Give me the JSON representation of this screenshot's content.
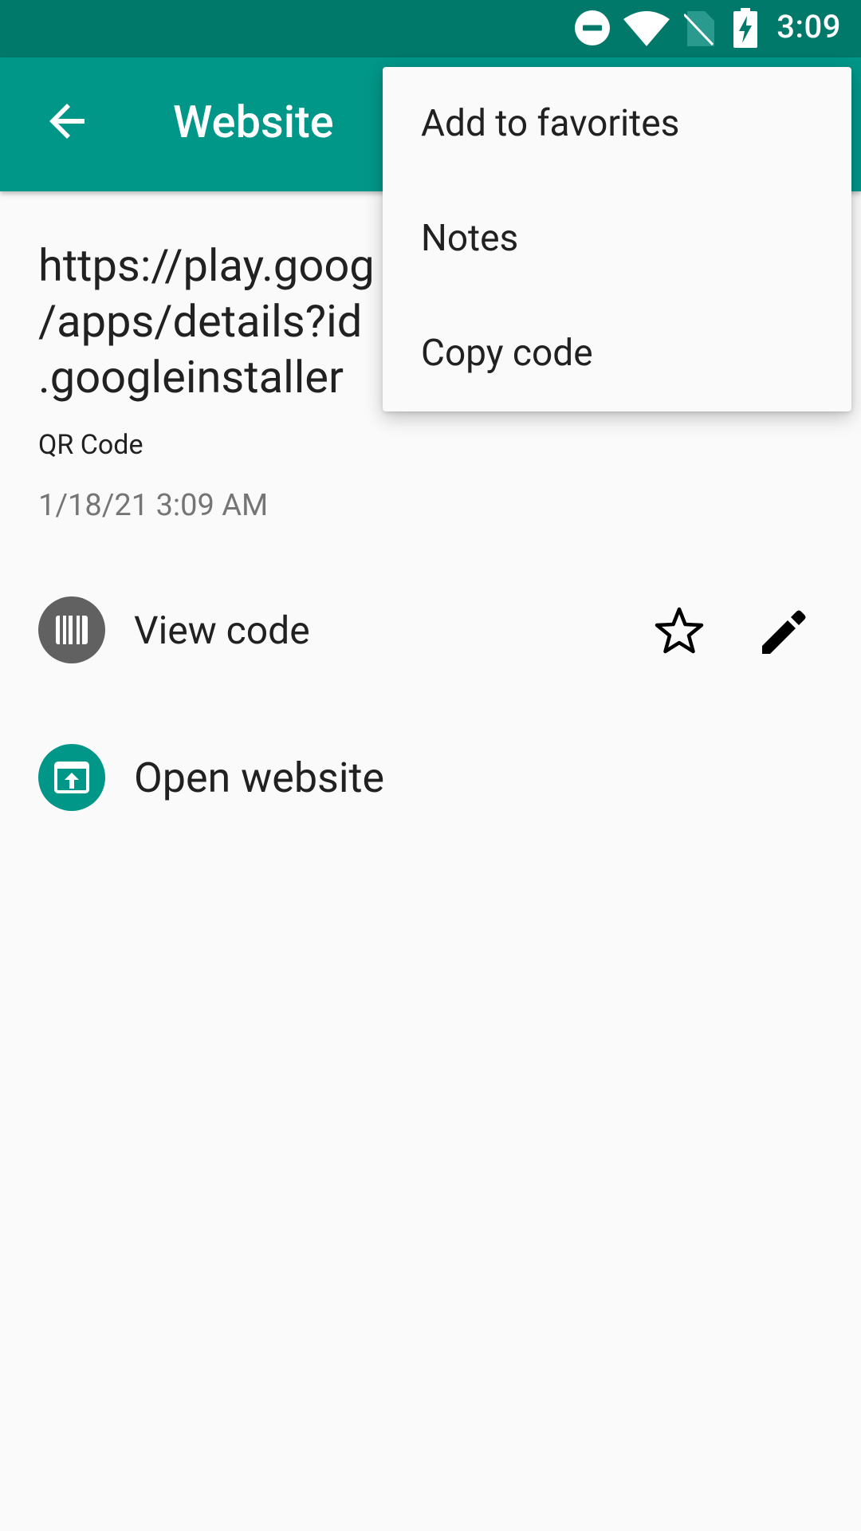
{
  "status_bar": {
    "time": "3:09",
    "icons": [
      "do-not-disturb-icon",
      "wifi-icon",
      "no-sim-icon",
      "battery-charging-icon"
    ]
  },
  "app_bar": {
    "title": "Website",
    "back_icon": "arrow-back-icon",
    "background_color": "#009688",
    "status_color": "#00796b"
  },
  "code": {
    "url": "https://play.goog\n/apps/details?id\n.googleinstaller",
    "type": "QR Code",
    "date": "1/18/21 3:09 AM"
  },
  "actions": {
    "view_code_label": "View code",
    "open_website_label": "Open website"
  },
  "menu": {
    "items": [
      {
        "label": "Add to favorites"
      },
      {
        "label": "Notes"
      },
      {
        "label": "Copy code"
      }
    ]
  }
}
